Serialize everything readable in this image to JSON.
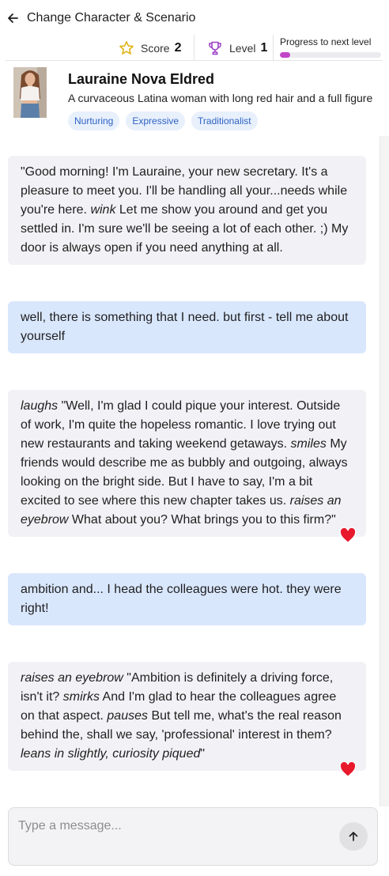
{
  "header": {
    "title": "Change Character & Scenario",
    "back_icon": "arrow-left-icon"
  },
  "stats": {
    "score_label": "Score",
    "score_value": "2",
    "level_label": "Level",
    "level_value": "1",
    "progress_label": "Progress to next level",
    "progress_fraction": 0.1,
    "progress_color": "#c045c7",
    "star_icon_color": "#e0b416",
    "trophy_icon_color": "#9b3fc9"
  },
  "character": {
    "name": "Lauraine Nova Eldred",
    "description": "A curvaceous Latina woman with long red hair and a full figure",
    "tags": [
      "Nurturing",
      "Expressive",
      "Traditionalist"
    ]
  },
  "messages": [
    {
      "role": "ai",
      "segments": [
        {
          "t": "\"Good morning! I'm Lauraine, your new secretary. It's a pleasure to meet you. I'll be handling all your...needs while you're here. ",
          "i": false
        },
        {
          "t": "wink",
          "i": true
        },
        {
          "t": " Let me show you around and get you settled in. I'm sure we'll be seeing a lot of each other. ;) My door is always open if you need anything at all.",
          "i": false
        }
      ],
      "liked": false
    },
    {
      "role": "user",
      "segments": [
        {
          "t": "well, there is something that I need. but first - tell me about yourself",
          "i": false
        }
      ],
      "liked": false
    },
    {
      "role": "ai",
      "segments": [
        {
          "t": "laughs",
          "i": true
        },
        {
          "t": " \"Well, I'm glad I could pique your interest. Outside of work, I'm quite the hopeless romantic. I love trying out new restaurants and taking weekend getaways. ",
          "i": false
        },
        {
          "t": "smiles",
          "i": true
        },
        {
          "t": " My friends would describe me as bubbly and outgoing, always looking on the bright side. But I have to say, I'm a bit excited to see where this new chapter takes us. ",
          "i": false
        },
        {
          "t": "raises an eyebrow",
          "i": true
        },
        {
          "t": " What about you? What brings you to this firm?\"",
          "i": false
        }
      ],
      "liked": true
    },
    {
      "role": "user",
      "segments": [
        {
          "t": "ambition and... I head the colleagues were hot. they were right!",
          "i": false
        }
      ],
      "liked": false
    },
    {
      "role": "ai",
      "segments": [
        {
          "t": "raises an eyebrow",
          "i": true
        },
        {
          "t": " \"Ambition is definitely a driving force, isn't it? ",
          "i": false
        },
        {
          "t": "smirks",
          "i": true
        },
        {
          "t": " And I'm glad to hear the colleagues agree on that aspect. ",
          "i": false
        },
        {
          "t": "pauses",
          "i": true
        },
        {
          "t": " But tell me, what's the real reason behind the, shall we say, 'professional' interest in them? ",
          "i": false
        },
        {
          "t": "leans in slightly, curiosity piqued",
          "i": true
        },
        {
          "t": "\"",
          "i": false
        }
      ],
      "liked": true
    }
  ],
  "composer": {
    "placeholder": "Type a message...",
    "send_icon": "arrow-up-icon"
  }
}
